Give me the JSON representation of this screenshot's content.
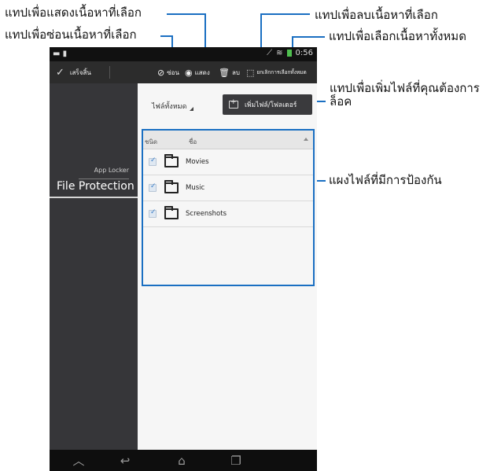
{
  "callouts": {
    "show_tab": "แทปเพื่อแสดงเนื้อหาที่เลือก",
    "hide_tab": "แทปเพื่อซ่อนเนื้อหาที่เลือก",
    "delete_tab": "แทปเพื่อลบเนื้อหาที่เลือก",
    "select_all_tab": "แทปเพื่อเลือกเนื้อหาทั้งหมด",
    "add_file_line1": "แทปเพื่อเพิ่มไฟล์ที่คุณต้องการ",
    "add_file_line2": "ล็อค",
    "file_panel": "แผงไฟล์ที่มีการป้องกัน"
  },
  "status_bar": {
    "time": "0:56"
  },
  "action_bar": {
    "done_label": "เสร็จสิ้น",
    "hide_label": "ซ่อน",
    "show_label": "แสดง",
    "delete_label": "ลบ",
    "deselect_all_label": "ยกเลิกการเลือกทั้งหมด"
  },
  "sidebar": {
    "app_locker": "App Locker",
    "file_protection": "File Protection"
  },
  "main": {
    "filter_label": "ไฟล์ทั้งหมด",
    "add_button_label": "เพิ่มไฟล์/โฟลเดอร์",
    "table": {
      "col_type": "ชนิด",
      "col_name": "ชื่อ",
      "rows": [
        {
          "name": "Movies",
          "checked": true
        },
        {
          "name": "Music",
          "checked": true
        },
        {
          "name": "Screenshots",
          "checked": true
        }
      ]
    }
  },
  "colors": {
    "callout_line": "#1a6fc2",
    "sidebar": "#363639",
    "action_bar": "#2c2c2c"
  }
}
